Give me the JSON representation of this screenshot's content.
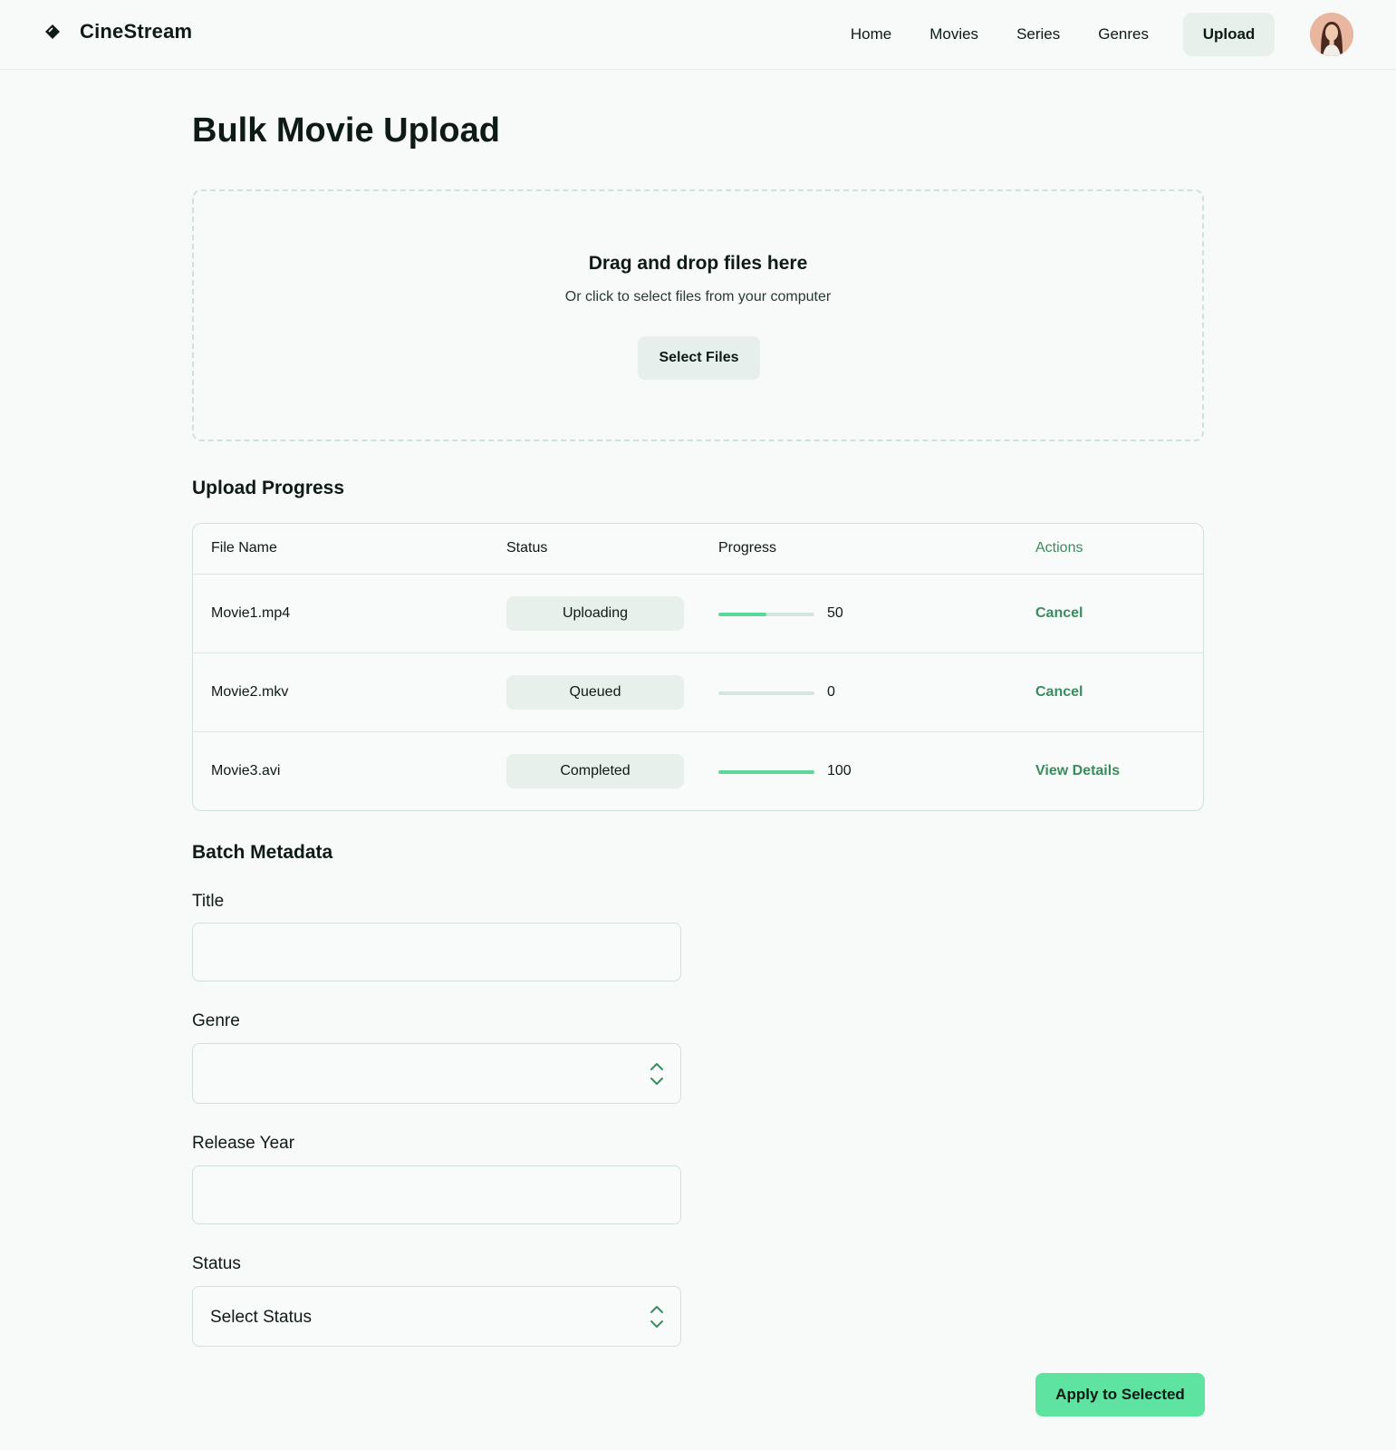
{
  "header": {
    "brand": "CineStream",
    "nav": [
      "Home",
      "Movies",
      "Series",
      "Genres"
    ],
    "upload_label": "Upload"
  },
  "page": {
    "title": "Bulk Movie Upload"
  },
  "dropzone": {
    "title": "Drag and drop files here",
    "subtitle": "Or click to select files from your computer",
    "button": "Select Files"
  },
  "upload_progress": {
    "title": "Upload Progress",
    "columns": [
      "File Name",
      "Status",
      "Progress",
      "Actions"
    ],
    "rows": [
      {
        "file": "Movie1.mp4",
        "status": "Uploading",
        "progress": 50,
        "progress_label": "50",
        "action": "Cancel"
      },
      {
        "file": "Movie2.mkv",
        "status": "Queued",
        "progress": 0,
        "progress_label": "0",
        "action": "Cancel"
      },
      {
        "file": "Movie3.avi",
        "status": "Completed",
        "progress": 100,
        "progress_label": "100",
        "action": "View Details"
      }
    ]
  },
  "batch": {
    "title": "Batch Metadata",
    "title_label": "Title",
    "genre_label": "Genre",
    "year_label": "Release Year",
    "status_label": "Status",
    "status_value": "Select Status",
    "apply_button": "Apply to Selected"
  },
  "colors": {
    "accent": "#5ee3a1",
    "link": "#3b8b60",
    "progress_fill": "#5ad89a",
    "background": "#f7faf9"
  },
  "icons": {
    "brand": "tag-diamond-icon",
    "select": "chevron-up-down-icon"
  }
}
